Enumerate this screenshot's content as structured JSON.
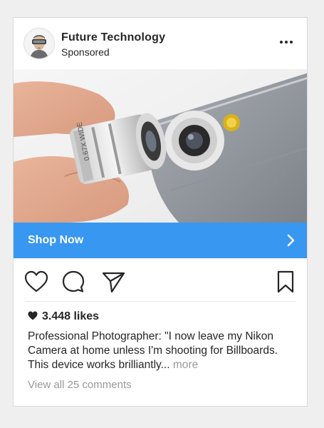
{
  "post": {
    "author": "Future Technology",
    "sponsored_label": "Sponsored",
    "cta_label": "Shop Now",
    "likes": "3.448 likes",
    "caption": "Professional Photographer: \"I now leave my Nikon Camera at home unless I'm shooting for Billboards. This device works brilliantly...",
    "more_label": "more",
    "view_comments": "View all 25 comments"
  },
  "image": {
    "lens_text": "0.67X WIDE"
  },
  "icons": {
    "menu": "more-dots-icon",
    "cta": "chevron-right-icon",
    "like": "heart-outline-icon",
    "comment": "comment-bubble-icon",
    "share": "paper-plane-icon",
    "save": "bookmark-icon",
    "likes": "heart-filled-icon"
  },
  "colors": {
    "cta_background": "#3897f0",
    "muted_text": "#999999",
    "primary_text": "#262626"
  }
}
